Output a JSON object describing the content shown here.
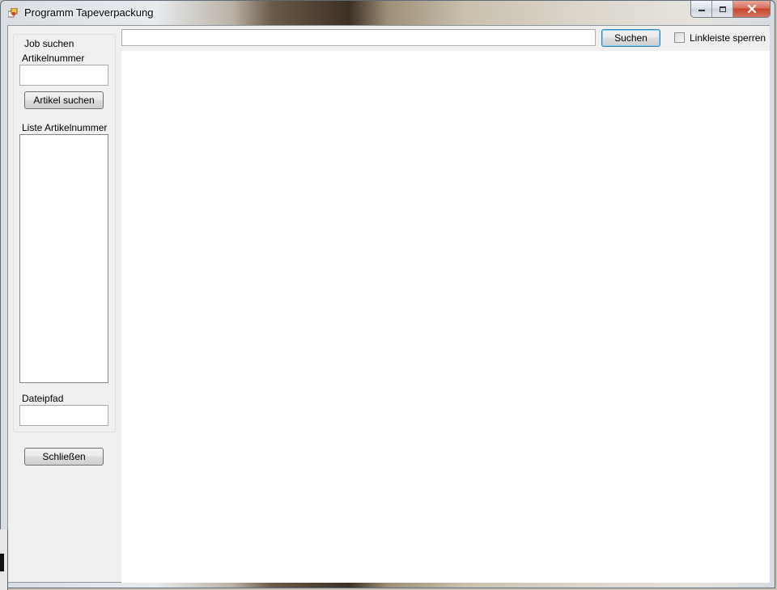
{
  "window": {
    "title": "Programm Tapeverpackung"
  },
  "left_panel": {
    "group_title": "Job suchen",
    "artikelnummer_label": "Artikelnummer",
    "artikelnummer_value": "",
    "artikel_suchen_label": "Artikel suchen",
    "liste_label": "Liste Artikelnummer",
    "liste_items": [],
    "dateipfad_label": "Dateipfad",
    "dateipfad_value": "",
    "schliessen_label": "Schließen"
  },
  "top_bar": {
    "url_value": "",
    "suchen_label": "Suchen",
    "linkleiste_label": "Linkleiste sperren",
    "linkleiste_checked": false
  },
  "colors": {
    "control_face": "#f0f0f0",
    "browser_bg": "#ffffff",
    "default_button_border": "#3c7fb1",
    "close_button": "#c6452b"
  },
  "icons": {
    "app": "app-icon",
    "minimize": "minimize-icon",
    "maximize": "maximize-icon",
    "close": "close-icon"
  }
}
